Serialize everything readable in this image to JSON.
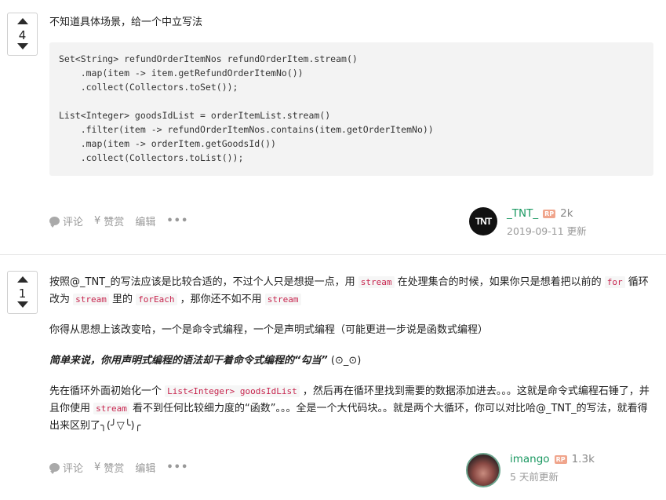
{
  "answers": [
    {
      "votes": "4",
      "text_intro": "不知道具体场景，给一个中立写法",
      "code": "Set<String> refundOrderItemNos refundOrderItem.stream()\n    .map(item -> item.getRefundOrderItemNo())\n    .collect(Collectors.toSet());\n\nList<Integer> goodsIdList = orderItemList.stream()\n    .filter(item -> refundOrderItemNos.contains(item.getOrderItemNo))\n    .map(item -> orderItem.getGoodsId())\n    .collect(Collectors.toList());",
      "actions": {
        "comment": "评论",
        "like": "赞赏",
        "edit": "编辑",
        "more": "•••",
        "like_prefix": "¥"
      },
      "author": {
        "name": "_TNT_",
        "badge": "RP",
        "rep": "2k",
        "date": "2019-09-11 更新",
        "avatar_text": "TNT"
      }
    },
    {
      "votes": "1",
      "p1_a": "按照@_TNT_的写法应该是比较合适的，不过个人只是想提一点，用 ",
      "p1_code1": "stream",
      "p1_b": " 在处理集合的时候，如果你只是想着把以前的 ",
      "p1_code2": "for",
      "p1_c": " 循环改为 ",
      "p1_code3": "stream",
      "p1_d": " 里的 ",
      "p1_code4": "forEach",
      "p1_e": " ，那你还不如不用 ",
      "p1_code5": "stream",
      "p2": "你得从思想上该改变哈，一个是命令式编程，一个是声明式编程（可能更进一步说是函数式编程）",
      "p3_emph": "简单来说，你用声明式编程的语法却干着命令式编程的“勾当”",
      "p3_tail": " (⊙_⊙)",
      "p4_a": "先在循环外面初始化一个 ",
      "p4_code1": "List<Integer> goodsIdList",
      "p4_b": " ，然后再在循环里找到需要的数据添加进去。。。这就是命令式编程石锤了，并且你使用 ",
      "p4_code2": "stream",
      "p4_c": " 看不到任何比较细力度的“函数”。。。全是一个大代码块。。就是两个大循环，你可以对比哈@_TNT_的写法，就看得出来区别了╮(╯▽╰)╭",
      "actions": {
        "comment": "评论",
        "like": "赞赏",
        "edit": "编辑",
        "more": "•••",
        "like_prefix": "¥"
      },
      "author": {
        "name": "imango",
        "badge": "RP",
        "rep": "1.3k",
        "date": "5 天前更新"
      }
    }
  ]
}
